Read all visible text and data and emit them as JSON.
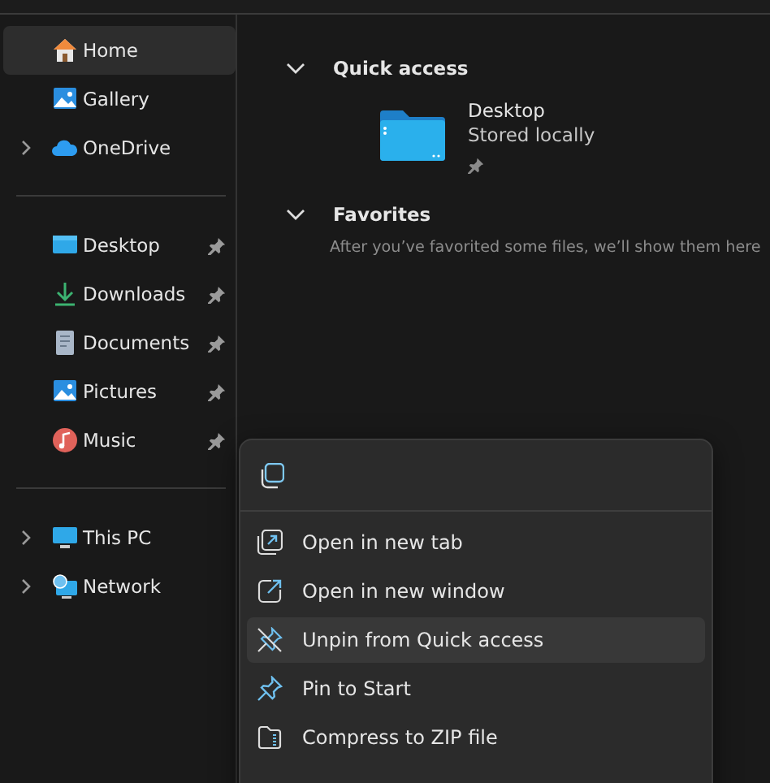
{
  "sidebar": {
    "groups": [
      {
        "items": [
          {
            "label": "Home",
            "kind": "home",
            "selected": true,
            "expandable": false,
            "pinned": false
          },
          {
            "label": "Gallery",
            "kind": "gallery",
            "selected": false,
            "expandable": false,
            "pinned": false
          },
          {
            "label": "OneDrive",
            "kind": "cloud",
            "selected": false,
            "expandable": true,
            "pinned": false
          }
        ]
      },
      {
        "items": [
          {
            "label": "Desktop",
            "kind": "desktop",
            "selected": false,
            "expandable": false,
            "pinned": true
          },
          {
            "label": "Downloads",
            "kind": "download",
            "selected": false,
            "expandable": false,
            "pinned": true
          },
          {
            "label": "Documents",
            "kind": "document",
            "selected": false,
            "expandable": false,
            "pinned": true
          },
          {
            "label": "Pictures",
            "kind": "gallery",
            "selected": false,
            "expandable": false,
            "pinned": true
          },
          {
            "label": "Music",
            "kind": "music",
            "selected": false,
            "expandable": false,
            "pinned": true
          }
        ]
      },
      {
        "items": [
          {
            "label": "This PC",
            "kind": "pc",
            "selected": false,
            "expandable": true,
            "pinned": false
          },
          {
            "label": "Network",
            "kind": "network",
            "selected": false,
            "expandable": true,
            "pinned": false
          }
        ]
      }
    ]
  },
  "sections": [
    {
      "title": "Quick access",
      "expanded": true,
      "tiles": [
        {
          "name": "Desktop",
          "detail": "Stored locally",
          "pinned": true
        }
      ]
    },
    {
      "title": "Favorites",
      "expanded": true,
      "message": "After you’ve favorited some files, we’ll show them here"
    }
  ],
  "context_menu": {
    "toolbar": [
      {
        "kind": "copy"
      }
    ],
    "items": [
      {
        "label": "Open in new tab",
        "kind": "newtab",
        "selected": false
      },
      {
        "label": "Open in new window",
        "kind": "newwindow",
        "selected": false
      },
      {
        "label": "Unpin from Quick access",
        "kind": "unpin",
        "selected": true
      },
      {
        "label": "Pin to Start",
        "kind": "pin",
        "selected": false
      },
      {
        "label": "Compress to ZIP file",
        "kind": "zip",
        "selected": false
      }
    ]
  }
}
